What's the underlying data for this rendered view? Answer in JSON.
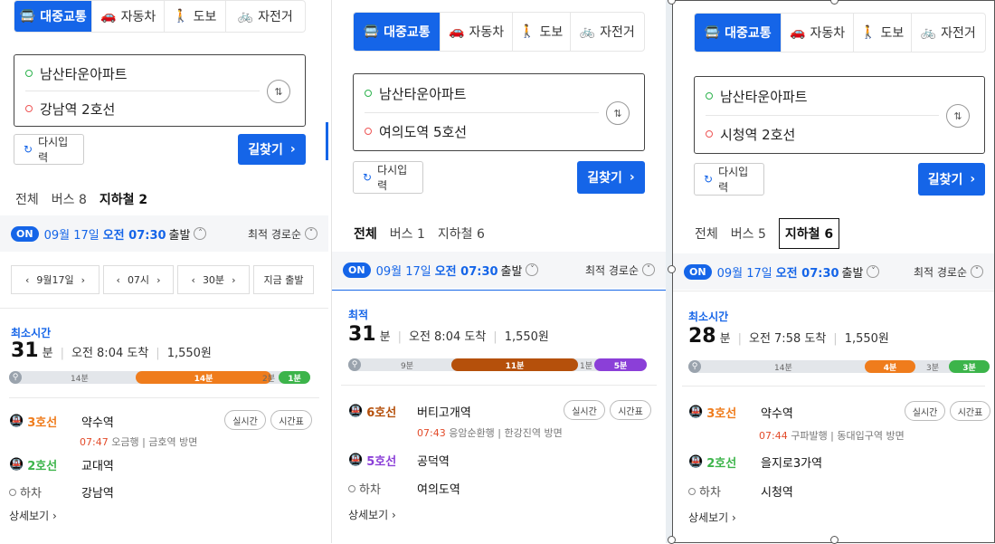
{
  "colors": {
    "accent": "#1565e8",
    "line3": "#ef7c1c",
    "line2": "#3cb44a",
    "line6": "#b5500b",
    "line5": "#8b3fd8"
  },
  "panels": [
    {
      "modes": [
        {
          "icon": "bus-icon",
          "glyph": "🚍",
          "label": "대중교통"
        },
        {
          "icon": "car-icon",
          "glyph": "🚗",
          "label": "자동차"
        },
        {
          "icon": "walk-icon",
          "glyph": "🚶",
          "label": "도보"
        },
        {
          "icon": "bike-icon",
          "glyph": "🚲",
          "label": "자전거"
        }
      ],
      "origin": "남산타운아파트",
      "destination": "강남역 2호선",
      "reset_label": "다시입력",
      "find_label": "길찾기",
      "tabs": [
        "전체",
        "버스 8",
        "지하철 2"
      ],
      "on_badge": "ON",
      "date": "09월 17일",
      "time": "오전 07:30",
      "depart": "출발",
      "sort": "최적 경로순",
      "picker": {
        "date": "9월17일",
        "hour": "07시",
        "minute": "30분",
        "now": "지금 출발"
      },
      "result": {
        "label": "최소시간",
        "minutes": "31",
        "unit": "분",
        "arrival": "오전 8:04 도착",
        "fare": "1,550원",
        "segments": {
          "walk1": "14분",
          "ride1": "14분",
          "walk2": "2분",
          "ride2": "1분"
        },
        "steps": [
          {
            "line": "3호선",
            "station": "약수역",
            "sub_time": "07:47",
            "sub_dest": "오금행",
            "sub_dir": "금호역 방면",
            "realtime": "실시간",
            "timetable": "시간표"
          },
          {
            "line": "2호선",
            "station": "교대역"
          },
          {
            "line": "하차",
            "station": "강남역"
          }
        ],
        "detail": "상세보기"
      }
    },
    {
      "origin": "남산타운아파트",
      "destination": "여의도역 5호선",
      "reset_label": "다시입력",
      "find_label": "길찾기",
      "tabs": [
        "전체",
        "버스 1",
        "지하철 6"
      ],
      "on_badge": "ON",
      "date": "09월 17일",
      "time": "오전 07:30",
      "depart": "출발",
      "sort": "최적 경로순",
      "result": {
        "label": "최적",
        "minutes": "31",
        "unit": "분",
        "arrival": "오전 8:04 도착",
        "fare": "1,550원",
        "segments": {
          "walk1": "9분",
          "ride1": "11분",
          "walk2": "1분",
          "ride2": "5분"
        },
        "steps": [
          {
            "line": "6호선",
            "station": "버티고개역",
            "sub_time": "07:43",
            "sub_dest": "응암순환행",
            "sub_dir": "한강진역 방면",
            "realtime": "실시간",
            "timetable": "시간표"
          },
          {
            "line": "5호선",
            "station": "공덕역"
          },
          {
            "line": "하차",
            "station": "여의도역"
          }
        ],
        "detail": "상세보기"
      }
    },
    {
      "origin": "남산타운아파트",
      "destination": "시청역 2호선",
      "reset_label": "다시입력",
      "find_label": "길찾기",
      "tabs": [
        "전체",
        "버스 5",
        "지하철 6"
      ],
      "on_badge": "ON",
      "date": "09월 17일",
      "time": "오전 07:30",
      "depart": "출발",
      "sort": "최적 경로순",
      "result": {
        "label": "최소시간",
        "minutes": "28",
        "unit": "분",
        "arrival": "오전 7:58 도착",
        "fare": "1,550원",
        "segments": {
          "walk1": "14분",
          "ride1": "4분",
          "walk2": "3분",
          "ride2": "3분"
        },
        "steps": [
          {
            "line": "3호선",
            "station": "약수역",
            "sub_time": "07:44",
            "sub_dest": "구파발행",
            "sub_dir": "동대입구역 방면",
            "realtime": "실시간",
            "timetable": "시간표"
          },
          {
            "line": "2호선",
            "station": "을지로3가역"
          },
          {
            "line": "하차",
            "station": "시청역"
          }
        ],
        "detail": "상세보기"
      }
    }
  ]
}
